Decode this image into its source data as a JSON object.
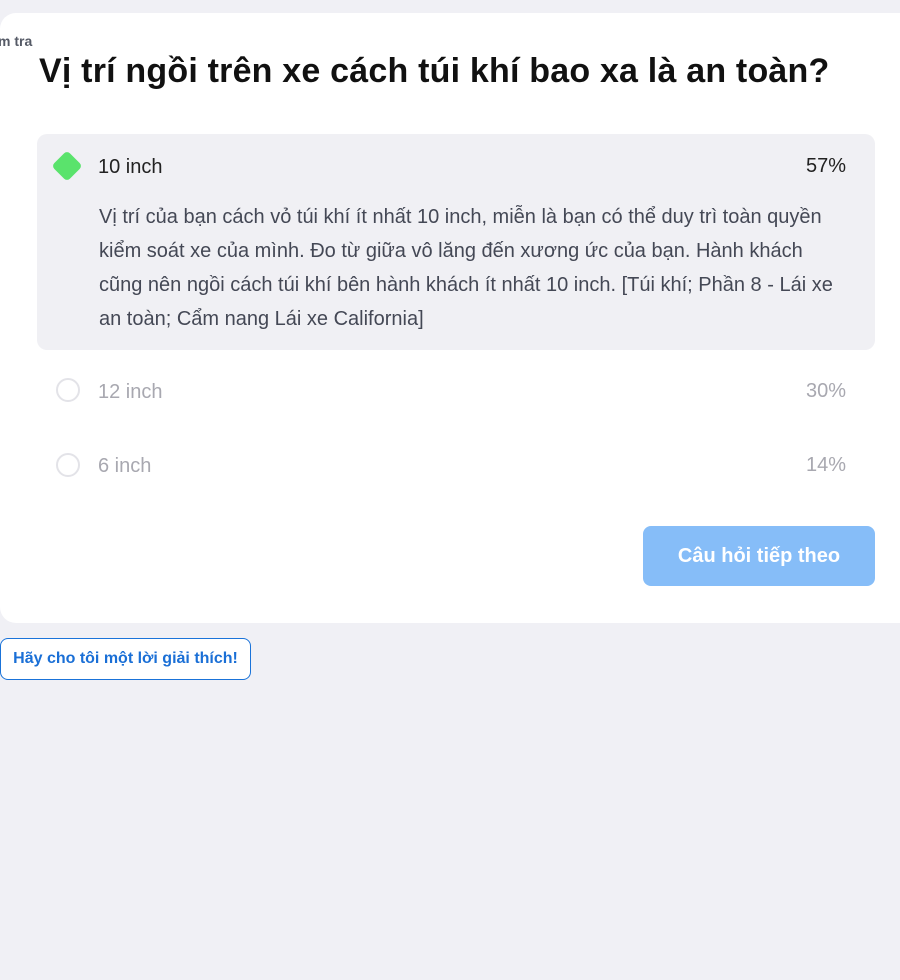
{
  "breadcrumb": "m tra",
  "question": "Vị trí ngồi trên xe cách túi khí bao xa là an toàn?",
  "options": [
    {
      "label": "10 inch",
      "percent": "57%",
      "selected": true,
      "correct": true,
      "explanation": "Vị trí của bạn cách vỏ túi khí ít nhất 10 inch, miễn là bạn có thể duy trì toàn quyền kiểm soát xe của mình. Đo từ giữa vô lăng đến xương ức của bạn. Hành khách cũng nên ngồi cách túi khí bên hành khách ít nhất 10 inch. [Túi khí; Phần 8 - Lái xe an toàn; Cẩm nang Lái xe California]"
    },
    {
      "label": "12 inch",
      "percent": "30%",
      "selected": false
    },
    {
      "label": "6 inch",
      "percent": "14%",
      "selected": false
    }
  ],
  "next_button": "Câu hỏi tiếp theo",
  "explain_button": "Hãy cho tôi một lời giải thích!",
  "colors": {
    "correct": "#5ae36c",
    "primary_button": "#86bdf8",
    "link_blue": "#1a6fd6",
    "page_background": "#f0f0f5"
  }
}
